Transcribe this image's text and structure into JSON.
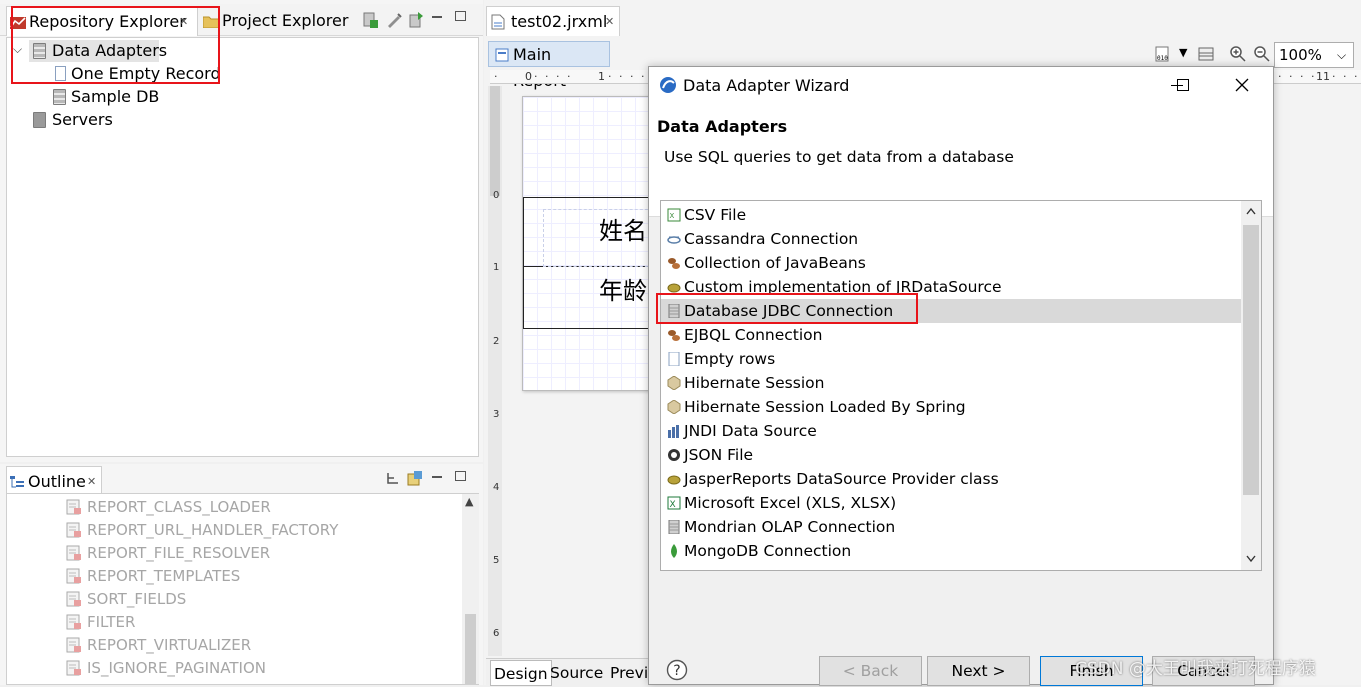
{
  "repository_panel": {
    "tabs": [
      {
        "label": "Repository Explorer",
        "active": true
      },
      {
        "label": "Project Explorer",
        "active": false
      }
    ],
    "tree": {
      "root_label": "Data Adapters",
      "children": [
        "One Empty Record",
        "Sample DB"
      ],
      "servers_label": "Servers"
    }
  },
  "outline_panel": {
    "title": "Outline",
    "items": [
      "REPORT_CLASS_LOADER",
      "REPORT_URL_HANDLER_FACTORY",
      "REPORT_FILE_RESOLVER",
      "REPORT_TEMPLATES",
      "SORT_FIELDS",
      "FILTER",
      "REPORT_VIRTUALIZER",
      "IS_IGNORE_PAGINATION"
    ]
  },
  "editor": {
    "file_tab": "test02.jrxml",
    "subtab": "Main Report",
    "zoom": "100%",
    "ruler_h": {
      "t0": "0",
      "t1": "1",
      "t11": "11"
    },
    "ruler_v": [
      "0",
      "1",
      "2",
      "3",
      "4",
      "5",
      "6"
    ],
    "canvas_labels": [
      "姓名",
      "年龄"
    ],
    "bottom_tabs": [
      "Design",
      "Source",
      "Previe"
    ]
  },
  "dialog": {
    "title": "Data Adapter Wizard",
    "heading": "Data Adapters",
    "description": "Use SQL queries to get data from a database",
    "adapters": [
      {
        "label": "CSV File",
        "icon": "csv-icon"
      },
      {
        "label": "Cassandra Connection",
        "icon": "cassandra-icon"
      },
      {
        "label": "Collection of JavaBeans",
        "icon": "beans-icon"
      },
      {
        "label": "Custom implementation of JRDataSource",
        "icon": "bean-icon"
      },
      {
        "label": "Database JDBC Connection",
        "icon": "database-icon",
        "selected": true
      },
      {
        "label": "EJBQL Connection",
        "icon": "beans-icon"
      },
      {
        "label": "Empty rows",
        "icon": "page-icon"
      },
      {
        "label": "Hibernate Session",
        "icon": "hibernate-icon"
      },
      {
        "label": "Hibernate Session Loaded By Spring",
        "icon": "hibernate-icon"
      },
      {
        "label": "JNDI Data Source",
        "icon": "jndi-icon"
      },
      {
        "label": "JSON File",
        "icon": "json-icon"
      },
      {
        "label": "JasperReports DataSource Provider class",
        "icon": "bean-icon"
      },
      {
        "label": "Microsoft Excel (XLS, XLSX)",
        "icon": "excel-icon"
      },
      {
        "label": "Mondrian OLAP Connection",
        "icon": "database-icon"
      },
      {
        "label": "MongoDB Connection",
        "icon": "mongodb-icon"
      }
    ],
    "buttons": {
      "back": "< Back",
      "next": "Next >",
      "finish": "Finish",
      "cancel": "Cancel"
    }
  },
  "watermark": "CSDN @大王叫我来打死程序猿"
}
